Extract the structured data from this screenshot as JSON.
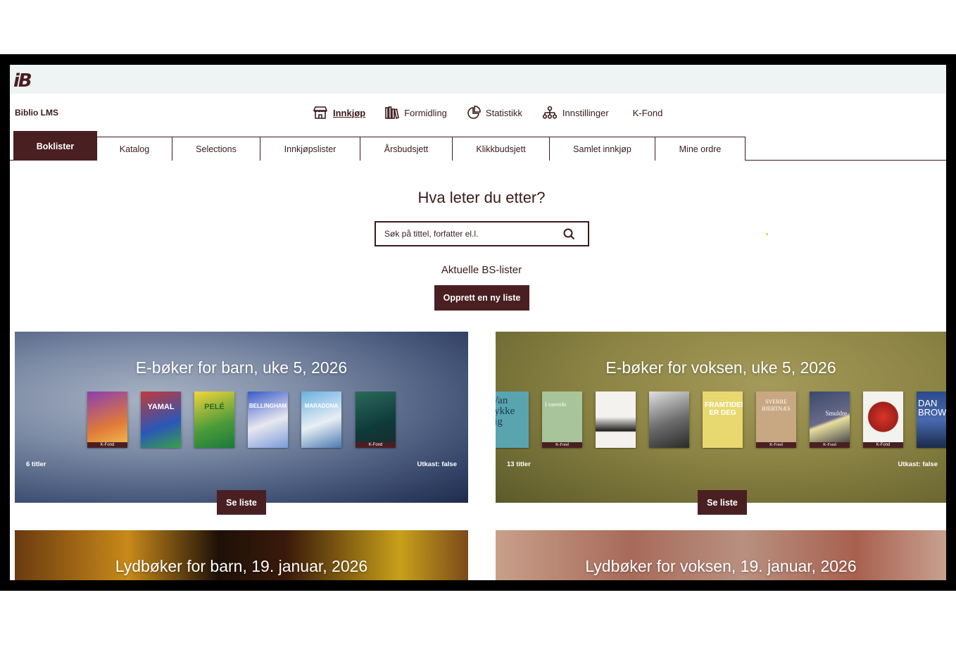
{
  "app": {
    "logo_text": "iB",
    "brand": "Biblio LMS"
  },
  "main_nav": [
    {
      "label": "Innkjøp",
      "icon": "store-icon",
      "active": true
    },
    {
      "label": "Formidling",
      "icon": "books-icon",
      "active": false
    },
    {
      "label": "Statistikk",
      "icon": "pie-chart-icon",
      "active": false
    },
    {
      "label": "Innstillinger",
      "icon": "hierarchy-icon",
      "active": false
    },
    {
      "label": "K-Fond",
      "icon": "",
      "active": false
    }
  ],
  "tabs": [
    {
      "label": "Boklister",
      "active": true
    },
    {
      "label": "Katalog"
    },
    {
      "label": "Selections"
    },
    {
      "label": "Innkjøpslister"
    },
    {
      "label": "Årsbudsjett"
    },
    {
      "label": "Klikkbudsjett"
    },
    {
      "label": "Samlet innkjøp"
    },
    {
      "label": "Mine ordre"
    }
  ],
  "search": {
    "heading": "Hva leter du etter?",
    "placeholder": "Søk på tittel, forfatter el.l."
  },
  "lists": {
    "heading": "Aktuelle BS-lister",
    "create_label": "Opprett en ny liste"
  },
  "cards": [
    {
      "title": "E-bøker for barn, uke 5, 2026",
      "count": "6 titler",
      "draft": "Utkast: false",
      "button": "Se liste",
      "covers": [
        {
          "text": "",
          "kfond": "K-Fond"
        },
        {
          "text": "YAMAL",
          "kfond": ""
        },
        {
          "text": "PELÉ",
          "kfond": ""
        },
        {
          "text": "BELLINGHAM",
          "kfond": ""
        },
        {
          "text": "MARADONA",
          "kfond": ""
        },
        {
          "text": "",
          "kfond": "K-Fond"
        }
      ]
    },
    {
      "title": "E-bøker for voksen, uke 5, 2026",
      "count": "13 titler",
      "draft": "Utkast: false",
      "button": "Se liste",
      "covers": [
        {
          "text": "Van lykke lig",
          "kfond": ""
        },
        {
          "text": "I varetekt",
          "kfond": "K-Fond"
        },
        {
          "text": "",
          "kfond": ""
        },
        {
          "text": "",
          "kfond": ""
        },
        {
          "text": "FRAMTIDEN ER DEG",
          "kfond": ""
        },
        {
          "text": "SVERRE BJERTNÆS",
          "kfond": "K-Fond"
        },
        {
          "text": "Smuldre",
          "kfond": "K-Fond"
        },
        {
          "text": "",
          "kfond": "K-Fond"
        },
        {
          "text": "DAN BROWN",
          "kfond": ""
        }
      ]
    },
    {
      "title": "Lydbøker for barn, 19. januar, 2026"
    },
    {
      "title": "Lydbøker for voksen, 19. januar, 2026"
    }
  ],
  "colors": {
    "brand": "#4a1f22",
    "topbar": "#eef4f3",
    "text": "#3a1a1a"
  }
}
